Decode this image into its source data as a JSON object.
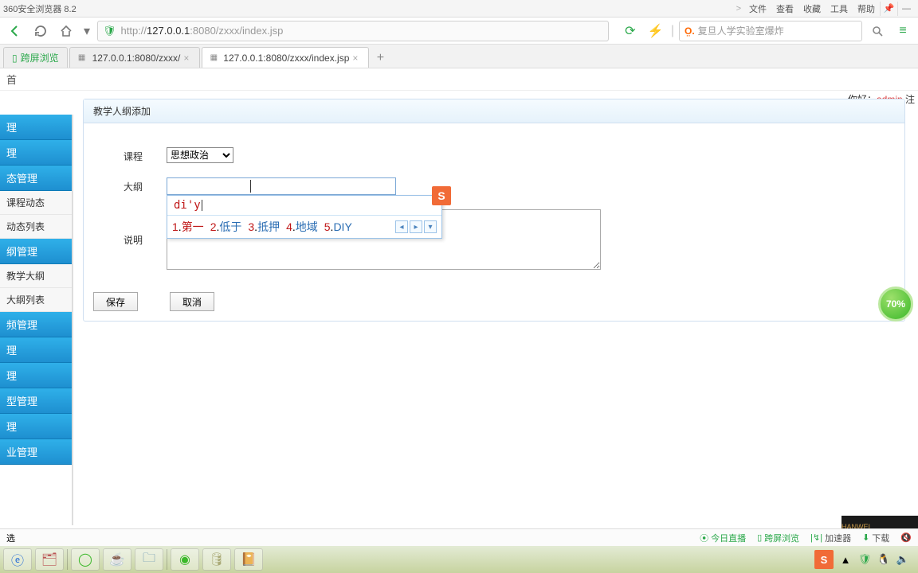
{
  "titlebar": {
    "app_name": "360安全浏览器 8.2",
    "menus": [
      "文件",
      "查看",
      "收藏",
      "工具",
      "帮助"
    ]
  },
  "navbar": {
    "url_prefix": "http://",
    "url_host": "127.0.0.1",
    "url_rest": ":8080/zxxx/index.jsp",
    "search_placeholder": "复旦人学实验室爆炸"
  },
  "tabs": [
    {
      "label": "跨屏浏览",
      "pinned": true
    },
    {
      "label": "127.0.0.1:8080/zxxx/",
      "active": false
    },
    {
      "label": "127.0.0.1:8080/zxxx/index.jsp",
      "active": true
    }
  ],
  "breadcrumb": "首",
  "greeting": {
    "prefix": "你好：",
    "user": "admin",
    "suffix": " 注"
  },
  "sidebar": [
    {
      "type": "cat",
      "label": "理"
    },
    {
      "type": "cat",
      "label": "理"
    },
    {
      "type": "cat",
      "label": "态管理"
    },
    {
      "type": "sub",
      "label": "课程动态"
    },
    {
      "type": "sub",
      "label": "动态列表"
    },
    {
      "type": "cat",
      "label": "纲管理"
    },
    {
      "type": "sub",
      "label": "教学大纲"
    },
    {
      "type": "sub",
      "label": "大纲列表"
    },
    {
      "type": "cat",
      "label": "频管理"
    },
    {
      "type": "cat",
      "label": "理"
    },
    {
      "type": "cat",
      "label": "理"
    },
    {
      "type": "cat",
      "label": "型管理"
    },
    {
      "type": "cat",
      "label": "理"
    },
    {
      "type": "cat",
      "label": "业管理"
    }
  ],
  "panel": {
    "title": "教学人纲添加",
    "labels": {
      "course": "课程",
      "outline": "大纲",
      "desc": "说明"
    },
    "course_value": "思想政治",
    "buttons": {
      "save": "保存",
      "cancel": "取消"
    }
  },
  "ime": {
    "pinyin": "di'y",
    "candidates": [
      {
        "n": "1",
        "w": "第一"
      },
      {
        "n": "2",
        "w": "低于"
      },
      {
        "n": "3",
        "w": "抵押"
      },
      {
        "n": "4",
        "w": "地域"
      },
      {
        "n": "5",
        "w": "DIY"
      }
    ],
    "logo": "S"
  },
  "float_badge": "70%",
  "statusbar": {
    "char": "选",
    "items": [
      "今日直播",
      "跨屏浏览",
      "加速器",
      "下载"
    ]
  },
  "bottom_black": "HANWEI PROGRAMMING"
}
